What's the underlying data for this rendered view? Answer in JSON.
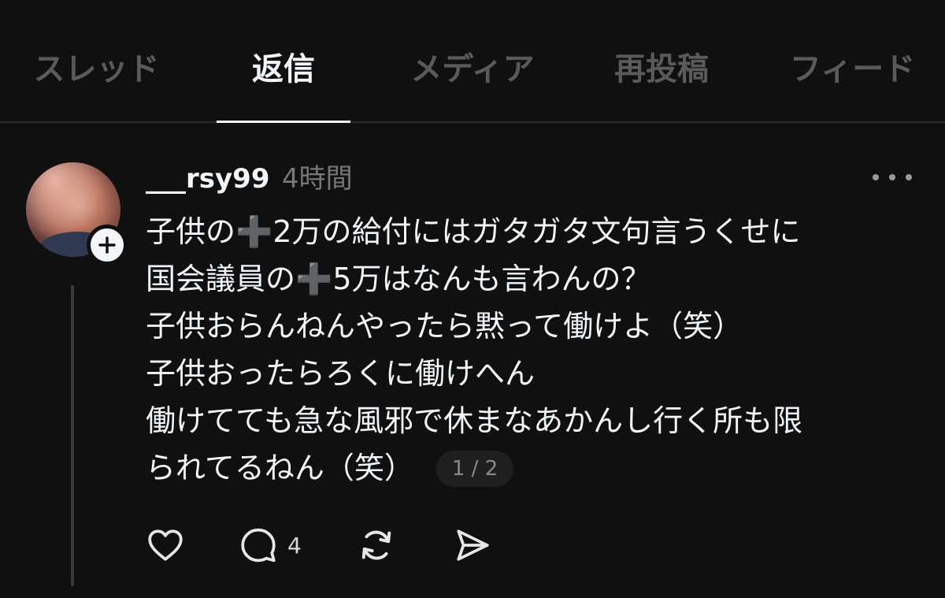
{
  "tabs": [
    {
      "label": "スレッド",
      "active": false
    },
    {
      "label": "返信",
      "active": true
    },
    {
      "label": "メディア",
      "active": false
    },
    {
      "label": "再投稿",
      "active": false
    },
    {
      "label": "フィード",
      "active": false
    }
  ],
  "post": {
    "username": "___rsy99",
    "time": "4時間",
    "lines": [
      "子供の➕2万の給付にはガタガタ文句言うくせに",
      "国会議員の➕5万はなんも言わんの？",
      "子供おらんねんやったら黙って働けよ（笑）",
      "子供おったらろくに働けへん",
      "働けてても急な風邪で休まなあかんし行く所も限",
      "られてるねん（笑）"
    ],
    "page_indicator": "1 / 2",
    "actions": {
      "like_icon": "heart-icon",
      "reply_icon": "comment-icon",
      "reply_count": "4",
      "repost_icon": "repost-icon",
      "share_icon": "send-icon"
    }
  },
  "colors": {
    "background": "#101010",
    "text": "#f3f5f7",
    "muted": "#777777",
    "inactive_tab": "#5a5a5a"
  }
}
